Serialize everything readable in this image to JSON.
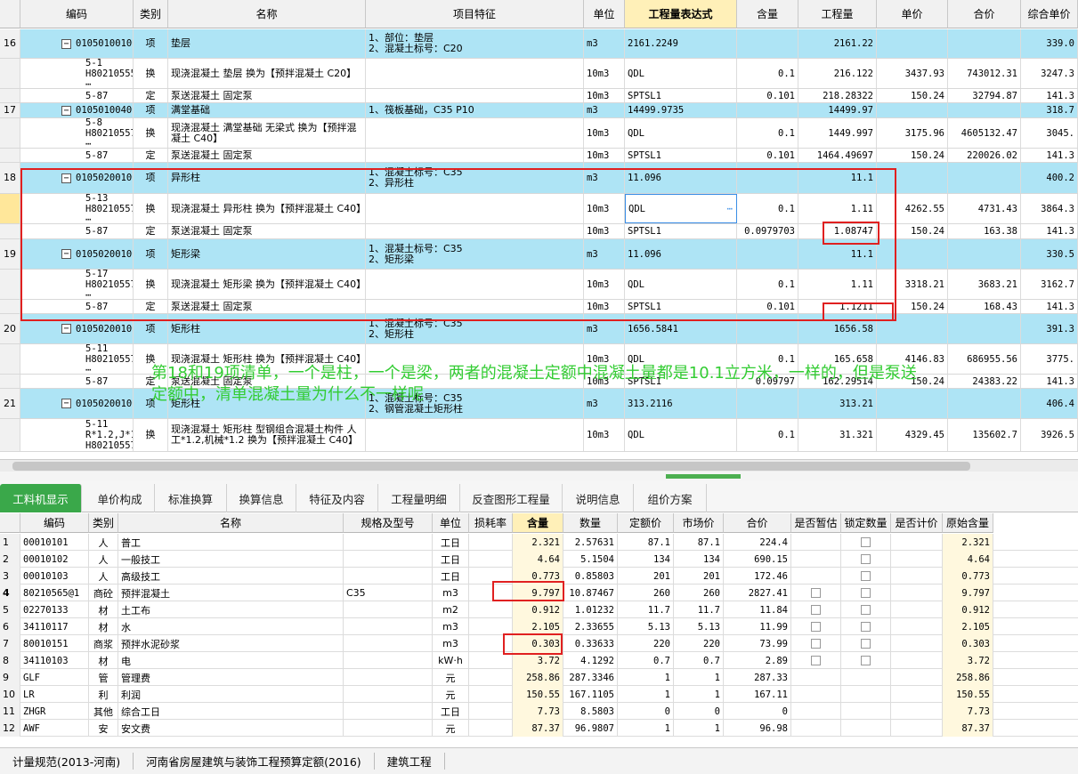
{
  "top_headers": [
    "",
    "编码",
    "类别",
    "名称",
    "项目特征",
    "单位",
    "工程量表达式",
    "含量",
    "工程量",
    "单价",
    "合价",
    "综合单价"
  ],
  "top_rows": [
    {
      "no": "16",
      "code": "010501001001",
      "type": "项",
      "name": "垫层",
      "feature": "1、部位：垫层\n2、混凝土标号：C20",
      "unit": "m3",
      "expr": "2161.2249",
      "content": "",
      "qty": "2161.22",
      "price": "",
      "total": "",
      "comp": "339.0",
      "qd": true
    },
    {
      "no": "",
      "code": "5-1\nH80210555 ⋯",
      "type": "换",
      "name": "现浇混凝土 垫层  换为【预拌混凝土 C20】",
      "feature": "",
      "unit": "10m3",
      "expr": "QDL",
      "content": "0.1",
      "qty": "216.122",
      "price": "3437.93",
      "total": "743012.31",
      "comp": "3247.3",
      "qd": false
    },
    {
      "no": "",
      "code": "5-87",
      "type": "定",
      "name": "泵送混凝土 固定泵",
      "feature": "",
      "unit": "10m3",
      "expr": "SPTSL1",
      "content": "0.101",
      "qty": "218.28322",
      "price": "150.24",
      "total": "32794.87",
      "comp": "141.3",
      "qd": false
    },
    {
      "no": "17",
      "code": "010501004001",
      "type": "项",
      "name": "满堂基础",
      "feature": "1、筏板基础，C35 P10",
      "unit": "m3",
      "expr": "14499.9735",
      "content": "",
      "qty": "14499.97",
      "price": "",
      "total": "",
      "comp": "318.7",
      "qd": true
    },
    {
      "no": "",
      "code": "5-8\nH80210557 ⋯",
      "type": "换",
      "name": "现浇混凝土 满堂基础 无梁式  换为【预拌混凝土 C40】",
      "feature": "",
      "unit": "10m3",
      "expr": "QDL",
      "content": "0.1",
      "qty": "1449.997",
      "price": "3175.96",
      "total": "4605132.47",
      "comp": "3045.",
      "qd": false
    },
    {
      "no": "",
      "code": "5-87",
      "type": "定",
      "name": "泵送混凝土 固定泵",
      "feature": "",
      "unit": "10m3",
      "expr": "SPTSL1",
      "content": "0.101",
      "qty": "1464.49697",
      "price": "150.24",
      "total": "220026.02",
      "comp": "141.3",
      "qd": false
    },
    {
      "no": "18",
      "code": "010502001001",
      "type": "项",
      "name": "异形柱",
      "feature": "1、混凝土标号：C35\n2、异形柱",
      "unit": "m3",
      "expr": "11.096",
      "content": "",
      "qty": "11.1",
      "price": "",
      "total": "",
      "comp": "400.2",
      "qd": true
    },
    {
      "no": "",
      "code": "5-13\nH80210557 ⋯",
      "type": "换",
      "name": "现浇混凝土 异形柱  换为【预拌混凝土 C40】",
      "feature": "",
      "unit": "10m3",
      "expr": "QDL",
      "content": "0.1",
      "qty": "1.11",
      "price": "4262.55",
      "total": "4731.43",
      "comp": "3864.3",
      "qd": false,
      "sel": true
    },
    {
      "no": "",
      "code": "5-87",
      "type": "定",
      "name": "泵送混凝土 固定泵",
      "feature": "",
      "unit": "10m3",
      "expr": "SPTSL1",
      "content": "0.0979703",
      "qty": "1.08747",
      "price": "150.24",
      "total": "163.38",
      "comp": "141.3",
      "qd": false
    },
    {
      "no": "19",
      "code": "010502001004",
      "type": "项",
      "name": "矩形梁",
      "feature": "1、混凝土标号：C35\n2、矩形梁",
      "unit": "m3",
      "expr": "11.096",
      "content": "",
      "qty": "11.1",
      "price": "",
      "total": "",
      "comp": "330.5",
      "qd": true
    },
    {
      "no": "",
      "code": "5-17\nH80210557 ⋯",
      "type": "换",
      "name": "现浇混凝土 矩形梁  换为【预拌混凝土 C40】",
      "feature": "",
      "unit": "10m3",
      "expr": "QDL",
      "content": "0.1",
      "qty": "1.11",
      "price": "3318.21",
      "total": "3683.21",
      "comp": "3162.7",
      "qd": false
    },
    {
      "no": "",
      "code": "5-87",
      "type": "定",
      "name": "泵送混凝土 固定泵",
      "feature": "",
      "unit": "10m3",
      "expr": "SPTSL1",
      "content": "0.101",
      "qty": "1.1211",
      "price": "150.24",
      "total": "168.43",
      "comp": "141.3",
      "qd": false
    },
    {
      "no": "20",
      "code": "010502001002",
      "type": "项",
      "name": "矩形柱",
      "feature": "1、混凝土标号：C35\n2、矩形柱",
      "unit": "m3",
      "expr": "1656.5841",
      "content": "",
      "qty": "1656.58",
      "price": "",
      "total": "",
      "comp": "391.3",
      "qd": true
    },
    {
      "no": "",
      "code": "5-11\nH80210557 ⋯",
      "type": "换",
      "name": "现浇混凝土 矩形柱  换为【预拌混凝土 C40】",
      "feature": "",
      "unit": "10m3",
      "expr": "QDL",
      "content": "0.1",
      "qty": "165.658",
      "price": "4146.83",
      "total": "686955.56",
      "comp": "3775.",
      "qd": false
    },
    {
      "no": "",
      "code": "5-87",
      "type": "定",
      "name": "泵送混凝土 固定泵",
      "feature": "",
      "unit": "10m3",
      "expr": "SPTSL1",
      "content": "0.09797",
      "qty": "162.29514",
      "price": "150.24",
      "total": "24383.22",
      "comp": "141.3",
      "qd": false
    },
    {
      "no": "21",
      "code": "010502001003",
      "type": "项",
      "name": "矩形柱",
      "feature": "1、混凝土标号：C35\n2、钢管混凝土矩形柱",
      "unit": "m3",
      "expr": "313.2116",
      "content": "",
      "qty": "313.21",
      "price": "",
      "total": "",
      "comp": "406.4",
      "qd": true
    },
    {
      "no": "",
      "code": "5-11\nR*1.2,J*1.2,\nH80210557 ⋯",
      "type": "换",
      "name": "现浇混凝土 矩形柱 型钢组合混凝土构件 人工*1.2,机械*1.2  换为【预拌混凝土 C40】",
      "feature": "",
      "unit": "10m3",
      "expr": "QDL",
      "content": "0.1",
      "qty": "31.321",
      "price": "4329.45",
      "total": "135602.7",
      "comp": "3926.5",
      "qd": false
    }
  ],
  "overlay_text": "第18和19项清单，一个是柱，一个是梁，两者的混凝土定额中混凝土量都是10.1立方米，一样的，但是泵送定额中，清单混凝土量为什么不一样呢",
  "tabs": [
    "工料机显示",
    "单价构成",
    "标准换算",
    "换算信息",
    "特征及内容",
    "工程量明细",
    "反查图形工程量",
    "说明信息",
    "组价方案"
  ],
  "bottom_headers": [
    "",
    "编码",
    "类别",
    "名称",
    "规格及型号",
    "单位",
    "损耗率",
    "含量",
    "数量",
    "定额价",
    "市场价",
    "合价",
    "是否暂估",
    "锁定数量",
    "是否计价",
    "原始含量"
  ],
  "bottom_rows": [
    {
      "no": "1",
      "code": "00010101",
      "type": "人",
      "name": "普工",
      "spec": "",
      "unit": "工日",
      "loss": "",
      "content": "2.321",
      "qty": "2.57631",
      "base": "87.1",
      "market": "87.1",
      "total": "224.4",
      "est": false,
      "lock": true,
      "orig": "2.321"
    },
    {
      "no": "2",
      "code": "00010102",
      "type": "人",
      "name": "一般技工",
      "spec": "",
      "unit": "工日",
      "loss": "",
      "content": "4.64",
      "qty": "5.1504",
      "base": "134",
      "market": "134",
      "total": "690.15",
      "est": false,
      "lock": true,
      "orig": "4.64"
    },
    {
      "no": "3",
      "code": "00010103",
      "type": "人",
      "name": "高级技工",
      "spec": "",
      "unit": "工日",
      "loss": "",
      "content": "0.773",
      "qty": "0.85803",
      "base": "201",
      "market": "201",
      "total": "172.46",
      "est": false,
      "lock": true,
      "orig": "0.773"
    },
    {
      "no": "4",
      "code": "80210565@1",
      "type": "商砼",
      "name": "预拌混凝土",
      "spec": "C35",
      "unit": "m3",
      "loss": "",
      "content": "9.797",
      "qty": "10.87467",
      "base": "260",
      "market": "260",
      "total": "2827.41",
      "est": true,
      "lock": true,
      "orig": "9.797"
    },
    {
      "no": "5",
      "code": "02270133",
      "type": "材",
      "name": "土工布",
      "spec": "",
      "unit": "m2",
      "loss": "",
      "content": "0.912",
      "qty": "1.01232",
      "base": "11.7",
      "market": "11.7",
      "total": "11.84",
      "est": true,
      "lock": true,
      "orig": "0.912"
    },
    {
      "no": "6",
      "code": "34110117",
      "type": "材",
      "name": "水",
      "spec": "",
      "unit": "m3",
      "loss": "",
      "content": "2.105",
      "qty": "2.33655",
      "base": "5.13",
      "market": "5.13",
      "total": "11.99",
      "est": true,
      "lock": true,
      "orig": "2.105"
    },
    {
      "no": "7",
      "code": "80010151",
      "type": "商浆",
      "name": "预拌水泥砂浆",
      "spec": "",
      "unit": "m3",
      "loss": "",
      "content": "0.303",
      "qty": "0.33633",
      "base": "220",
      "market": "220",
      "total": "73.99",
      "est": true,
      "lock": true,
      "orig": "0.303"
    },
    {
      "no": "8",
      "code": "34110103",
      "type": "材",
      "name": "电",
      "spec": "",
      "unit": "kW·h",
      "loss": "",
      "content": "3.72",
      "qty": "4.1292",
      "base": "0.7",
      "market": "0.7",
      "total": "2.89",
      "est": true,
      "lock": true,
      "orig": "3.72"
    },
    {
      "no": "9",
      "code": "GLF",
      "type": "管",
      "name": "管理费",
      "spec": "",
      "unit": "元",
      "loss": "",
      "content": "258.86",
      "qty": "287.3346",
      "base": "1",
      "market": "1",
      "total": "287.33",
      "est": false,
      "lock": false,
      "orig": "258.86"
    },
    {
      "no": "10",
      "code": "LR",
      "type": "利",
      "name": "利润",
      "spec": "",
      "unit": "元",
      "loss": "",
      "content": "150.55",
      "qty": "167.1105",
      "base": "1",
      "market": "1",
      "total": "167.11",
      "est": false,
      "lock": false,
      "orig": "150.55"
    },
    {
      "no": "11",
      "code": "ZHGR",
      "type": "其他",
      "name": "综合工日",
      "spec": "",
      "unit": "工日",
      "loss": "",
      "content": "7.73",
      "qty": "8.5803",
      "base": "0",
      "market": "0",
      "total": "0",
      "est": false,
      "lock": false,
      "orig": "7.73"
    },
    {
      "no": "12",
      "code": "AWF",
      "type": "安",
      "name": "安文费",
      "spec": "",
      "unit": "元",
      "loss": "",
      "content": "87.37",
      "qty": "96.9807",
      "base": "1",
      "market": "1",
      "total": "96.98",
      "est": false,
      "lock": false,
      "orig": "87.37"
    }
  ],
  "status": [
    "计量规范(2013-河南)",
    "河南省房屋建筑与装饰工程预算定额(2016)",
    "建筑工程"
  ]
}
